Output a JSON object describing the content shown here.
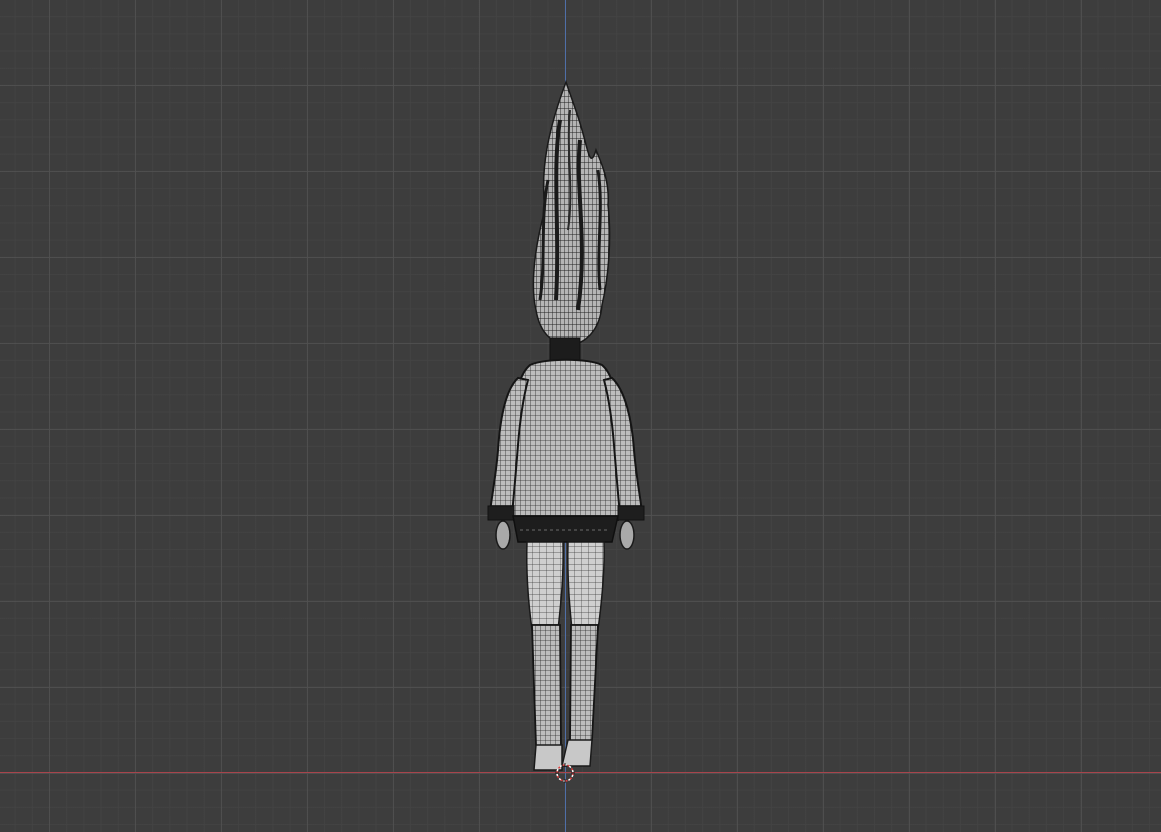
{
  "viewport": {
    "background_color": "#3d3d3d",
    "grid_color": "#505050",
    "axis_z_color": "#4f6fa8",
    "axis_x_color": "#a8444c"
  },
  "scene": {
    "object": "character-mesh-wireframe",
    "view": "back-orthographic"
  },
  "icons": {
    "cursor": "3d-cursor-icon"
  }
}
